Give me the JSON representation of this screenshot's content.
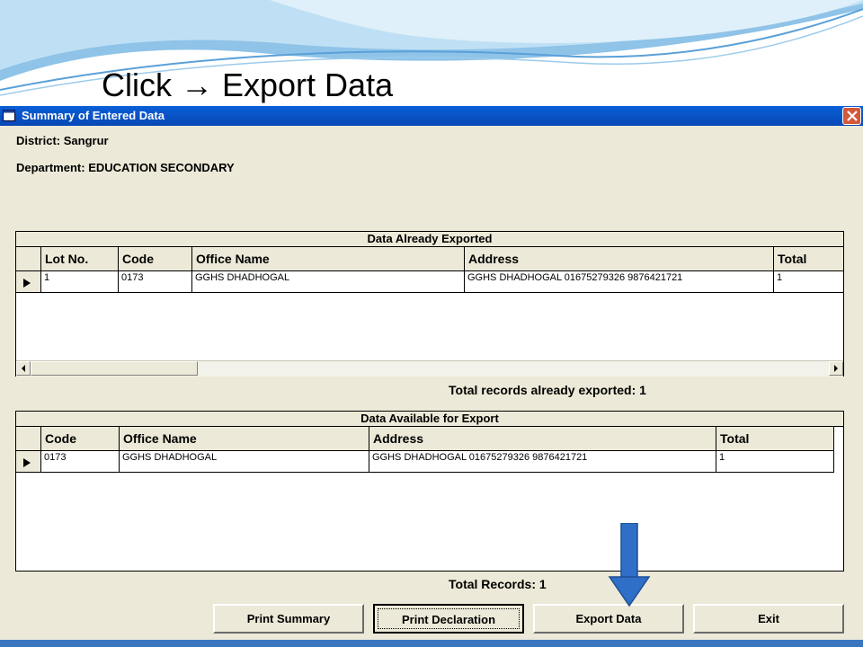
{
  "slide": {
    "title": "Click → Export Data"
  },
  "window": {
    "title": "Summary of Entered Data",
    "district_label": "District:",
    "district_value": "Sangrur",
    "department_label": "Department:",
    "department_value": "EDUCATION SECONDARY"
  },
  "exported_grid": {
    "caption": "Data Already Exported",
    "columns": [
      "Lot No.",
      "Code",
      "Office Name",
      "Address",
      "Total"
    ],
    "rows": [
      [
        "1",
        "0173",
        "GGHS DHADHOGAL",
        "GGHS DHADHOGAL  01675279326  9876421721",
        "1"
      ]
    ],
    "total_text": "Total records already exported: 1"
  },
  "available_grid": {
    "caption": "Data Available for Export",
    "columns": [
      "Code",
      "Office Name",
      "Address",
      "Total"
    ],
    "rows": [
      [
        "0173",
        "GGHS DHADHOGAL",
        "GGHS DHADHOGAL  01675279326  9876421721",
        "1"
      ]
    ],
    "total_text": "Total Records: 1"
  },
  "buttons": {
    "print_summary": "Print Summary",
    "print_declaration": "Print Declaration",
    "export_data": "Export Data",
    "exit": "Exit"
  },
  "colors": {
    "titlebar": "#0a5fd6",
    "window_bg": "#ece9d8",
    "arrow": "#2f6fc7"
  },
  "icons": [
    "app-window-icon",
    "close-icon",
    "row-pointer-icon",
    "scroll-left-icon",
    "scroll-right-icon",
    "down-arrow-annotation"
  ]
}
